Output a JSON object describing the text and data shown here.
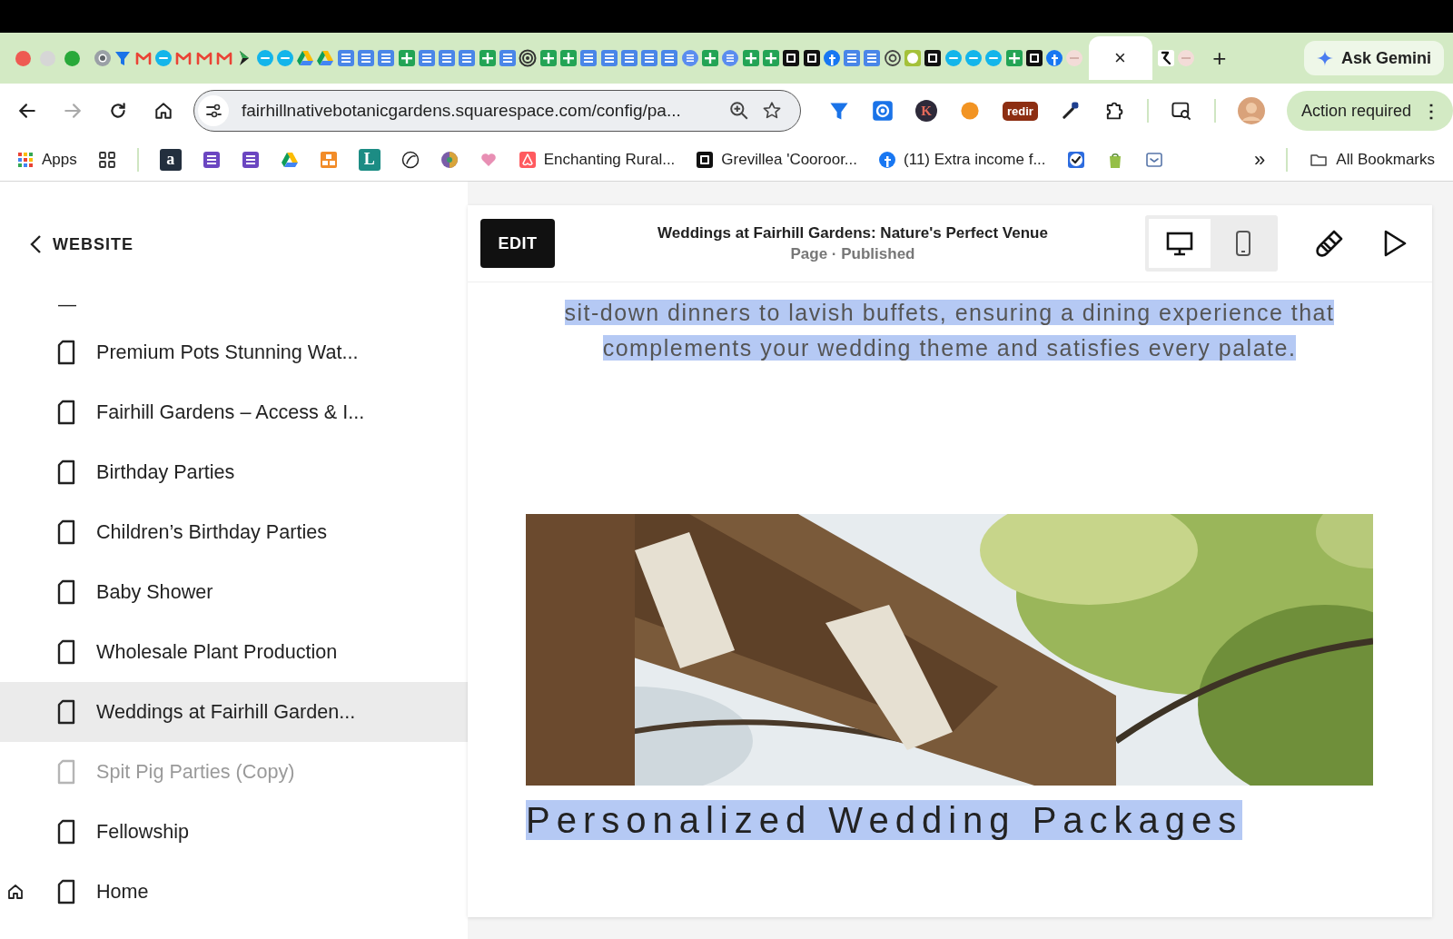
{
  "tabs": [
    {
      "kind": "chrome",
      "selected": false
    },
    {
      "kind": "funnel",
      "selected": false
    },
    {
      "kind": "gmail",
      "selected": false
    },
    {
      "kind": "xero",
      "selected": false
    },
    {
      "kind": "gmail",
      "selected": false
    },
    {
      "kind": "gmail",
      "selected": false
    },
    {
      "kind": "gmail",
      "selected": false
    },
    {
      "kind": "play",
      "selected": false
    },
    {
      "kind": "xero",
      "selected": false
    },
    {
      "kind": "xero",
      "selected": false
    },
    {
      "kind": "drive",
      "selected": false
    },
    {
      "kind": "drive",
      "selected": false
    },
    {
      "kind": "docs",
      "selected": false
    },
    {
      "kind": "docs",
      "selected": false
    },
    {
      "kind": "docs",
      "selected": false
    },
    {
      "kind": "sheets",
      "selected": false
    },
    {
      "kind": "docs",
      "selected": false
    },
    {
      "kind": "docs",
      "selected": false
    },
    {
      "kind": "docs",
      "selected": false
    },
    {
      "kind": "sheets",
      "selected": false
    },
    {
      "kind": "docs",
      "selected": false
    },
    {
      "kind": "target",
      "selected": false
    },
    {
      "kind": "sheets",
      "selected": false
    },
    {
      "kind": "sheets",
      "selected": false
    },
    {
      "kind": "docs",
      "selected": false
    },
    {
      "kind": "docs",
      "selected": false
    },
    {
      "kind": "docs",
      "selected": false
    },
    {
      "kind": "docs",
      "selected": false
    },
    {
      "kind": "docs",
      "selected": false
    },
    {
      "kind": "listc",
      "selected": false
    },
    {
      "kind": "sheets",
      "selected": false
    },
    {
      "kind": "listc",
      "selected": false
    },
    {
      "kind": "sheets",
      "selected": false
    },
    {
      "kind": "sheets",
      "selected": false
    },
    {
      "kind": "square",
      "selected": false
    },
    {
      "kind": "square",
      "selected": false
    },
    {
      "kind": "facebook",
      "selected": false
    },
    {
      "kind": "docs",
      "selected": false
    },
    {
      "kind": "docs",
      "selected": false
    },
    {
      "kind": "openai",
      "selected": false
    },
    {
      "kind": "lime",
      "selected": false
    },
    {
      "kind": "square",
      "selected": false
    },
    {
      "kind": "xero",
      "selected": false
    },
    {
      "kind": "xero",
      "selected": false
    },
    {
      "kind": "xero",
      "selected": false
    },
    {
      "kind": "sheets",
      "selected": false
    },
    {
      "kind": "square",
      "selected": false
    },
    {
      "kind": "facebook",
      "selected": false
    },
    {
      "kind": "faded",
      "selected": false
    },
    {
      "close": "×",
      "selected": true
    },
    {
      "kind": "rtab",
      "selected": false
    },
    {
      "kind": "faded",
      "selected": false
    }
  ],
  "new_tab": "+",
  "ask_gemini": "Ask Gemini",
  "address": {
    "url": "fairhillnativebotanicgardens.squarespace.com/config/pa..."
  },
  "extensions": [
    {
      "kind": "funnel"
    },
    {
      "kind": "gear"
    },
    {
      "kind": "letter",
      "glyph": "K",
      "color": "#2e2a3a"
    },
    {
      "kind": "swirl"
    },
    {
      "kind": "badge",
      "label": "redir"
    },
    {
      "kind": "dropper"
    },
    {
      "kind": "puzzle"
    }
  ],
  "action_button": {
    "label": "Action required",
    "menu": "⋮"
  },
  "bookmarks": [
    {
      "kind": "apps",
      "label": "Apps"
    },
    {
      "kind": "grid"
    },
    {
      "kind": "letter",
      "glyph": "a",
      "color": "#232f3e"
    },
    {
      "kind": "listp"
    },
    {
      "kind": "listp"
    },
    {
      "kind": "drive"
    },
    {
      "kind": "orange"
    },
    {
      "kind": "letter",
      "glyph": "L",
      "color": "#1c8c84"
    },
    {
      "kind": "lion"
    },
    {
      "kind": "ball"
    },
    {
      "kind": "heart"
    },
    {
      "kind": "airbnb",
      "label": "Enchanting Rural..."
    },
    {
      "kind": "square",
      "label": "Grevillea 'Cooroor..."
    },
    {
      "kind": "facebook",
      "label": "(11) Extra income f..."
    },
    {
      "kind": "check"
    },
    {
      "kind": "shopify"
    },
    {
      "kind": "pocket"
    }
  ],
  "more_bookmarks": "»",
  "all_bookmarks": "All Bookmarks",
  "sidebar": {
    "back_label": "WEBSITE",
    "separator": "—",
    "items": [
      {
        "label": "Premium Pots Stunning Wat...",
        "selected": false,
        "disabled": false,
        "homepage": false
      },
      {
        "label": "Fairhill Gardens – Access & I...",
        "selected": false,
        "disabled": false,
        "homepage": false
      },
      {
        "label": "Birthday Parties",
        "selected": false,
        "disabled": false,
        "homepage": false
      },
      {
        "label": "Children’s Birthday Parties",
        "selected": false,
        "disabled": false,
        "homepage": false
      },
      {
        "label": "Baby Shower",
        "selected": false,
        "disabled": false,
        "homepage": false
      },
      {
        "label": "Wholesale Plant Production",
        "selected": false,
        "disabled": false,
        "homepage": false
      },
      {
        "label": "Weddings at Fairhill Garden...",
        "selected": true,
        "disabled": false,
        "homepage": false
      },
      {
        "label": "Spit Pig Parties (Copy)",
        "selected": false,
        "disabled": true,
        "homepage": false
      },
      {
        "label": "Fellowship",
        "selected": false,
        "disabled": false,
        "homepage": false
      },
      {
        "label": "Home",
        "selected": false,
        "disabled": false,
        "homepage": true
      }
    ]
  },
  "editor": {
    "edit_button": "EDIT",
    "title": "Weddings at Fairhill Gardens: Nature's Perfect Venue",
    "subtitle": "Page · Published",
    "views": [
      {
        "kind": "desktop",
        "selected": true
      },
      {
        "kind": "mobile",
        "selected": false
      }
    ],
    "paragraph_lines": [
      "sit-down dinners to lavish buffets, ensuring a dining experience that",
      "complements your wedding theme and satisfies every palate."
    ],
    "heading": "Personalized Wedding Packages"
  }
}
